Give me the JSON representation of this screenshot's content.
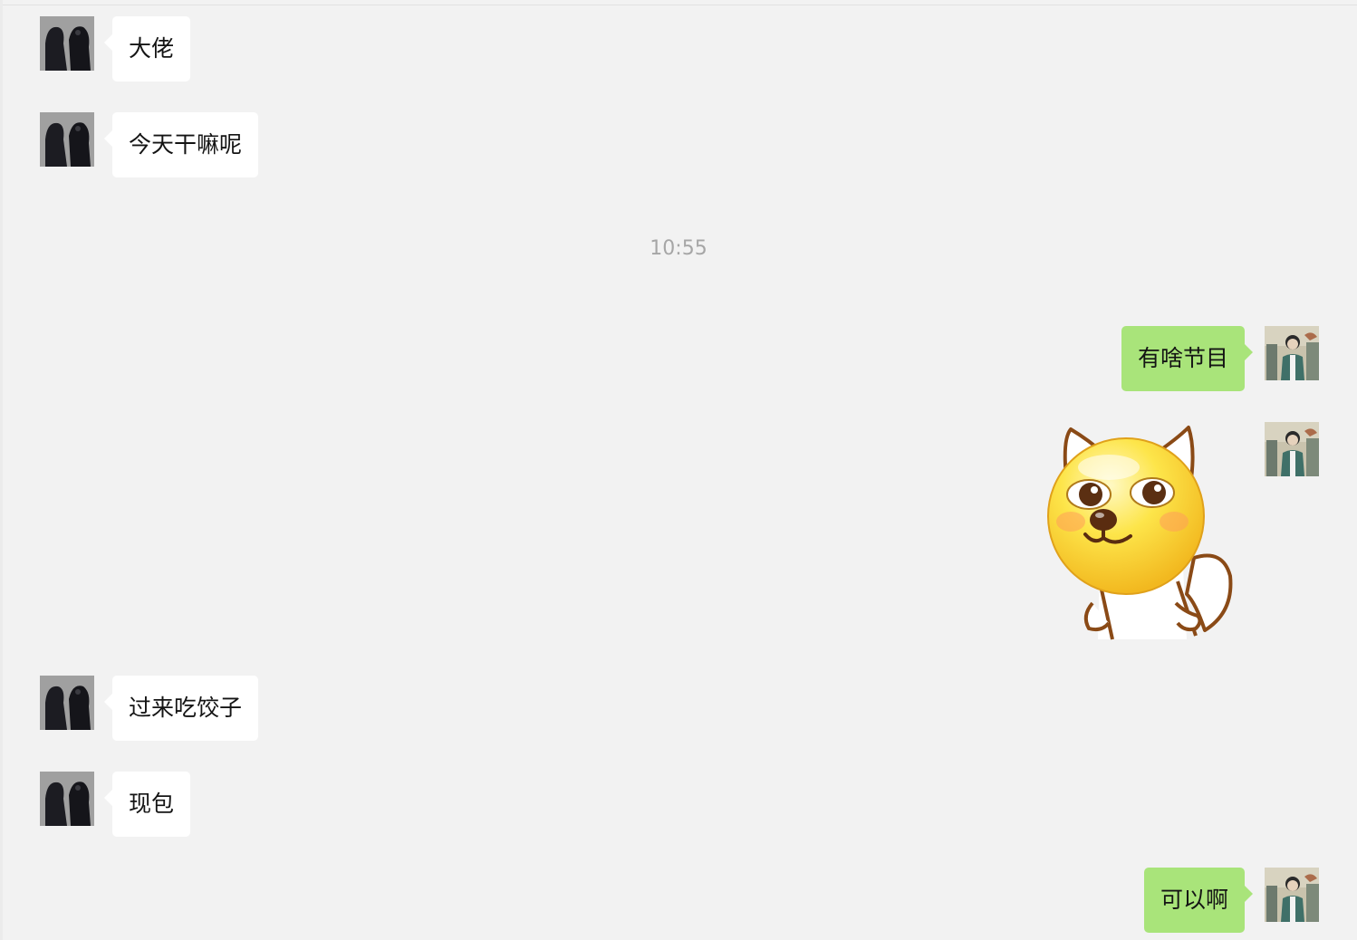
{
  "chat": {
    "timestamp": "10:55",
    "messages": [
      {
        "side": "left",
        "text": "大佬"
      },
      {
        "side": "left",
        "text": "今天干嘛呢"
      },
      {
        "side": "right",
        "text": "有啥节目"
      },
      {
        "side": "right",
        "sticker": "shiba-dog-emoji-sticker"
      },
      {
        "side": "left",
        "text": "过来吃饺子"
      },
      {
        "side": "left",
        "text": "现包"
      },
      {
        "side": "right",
        "text": "可以啊"
      }
    ]
  },
  "colors": {
    "background": "#f2f2f2",
    "incoming_bubble": "#ffffff",
    "outgoing_bubble": "#a9e47a",
    "timestamp_text": "#a6a6a6"
  }
}
